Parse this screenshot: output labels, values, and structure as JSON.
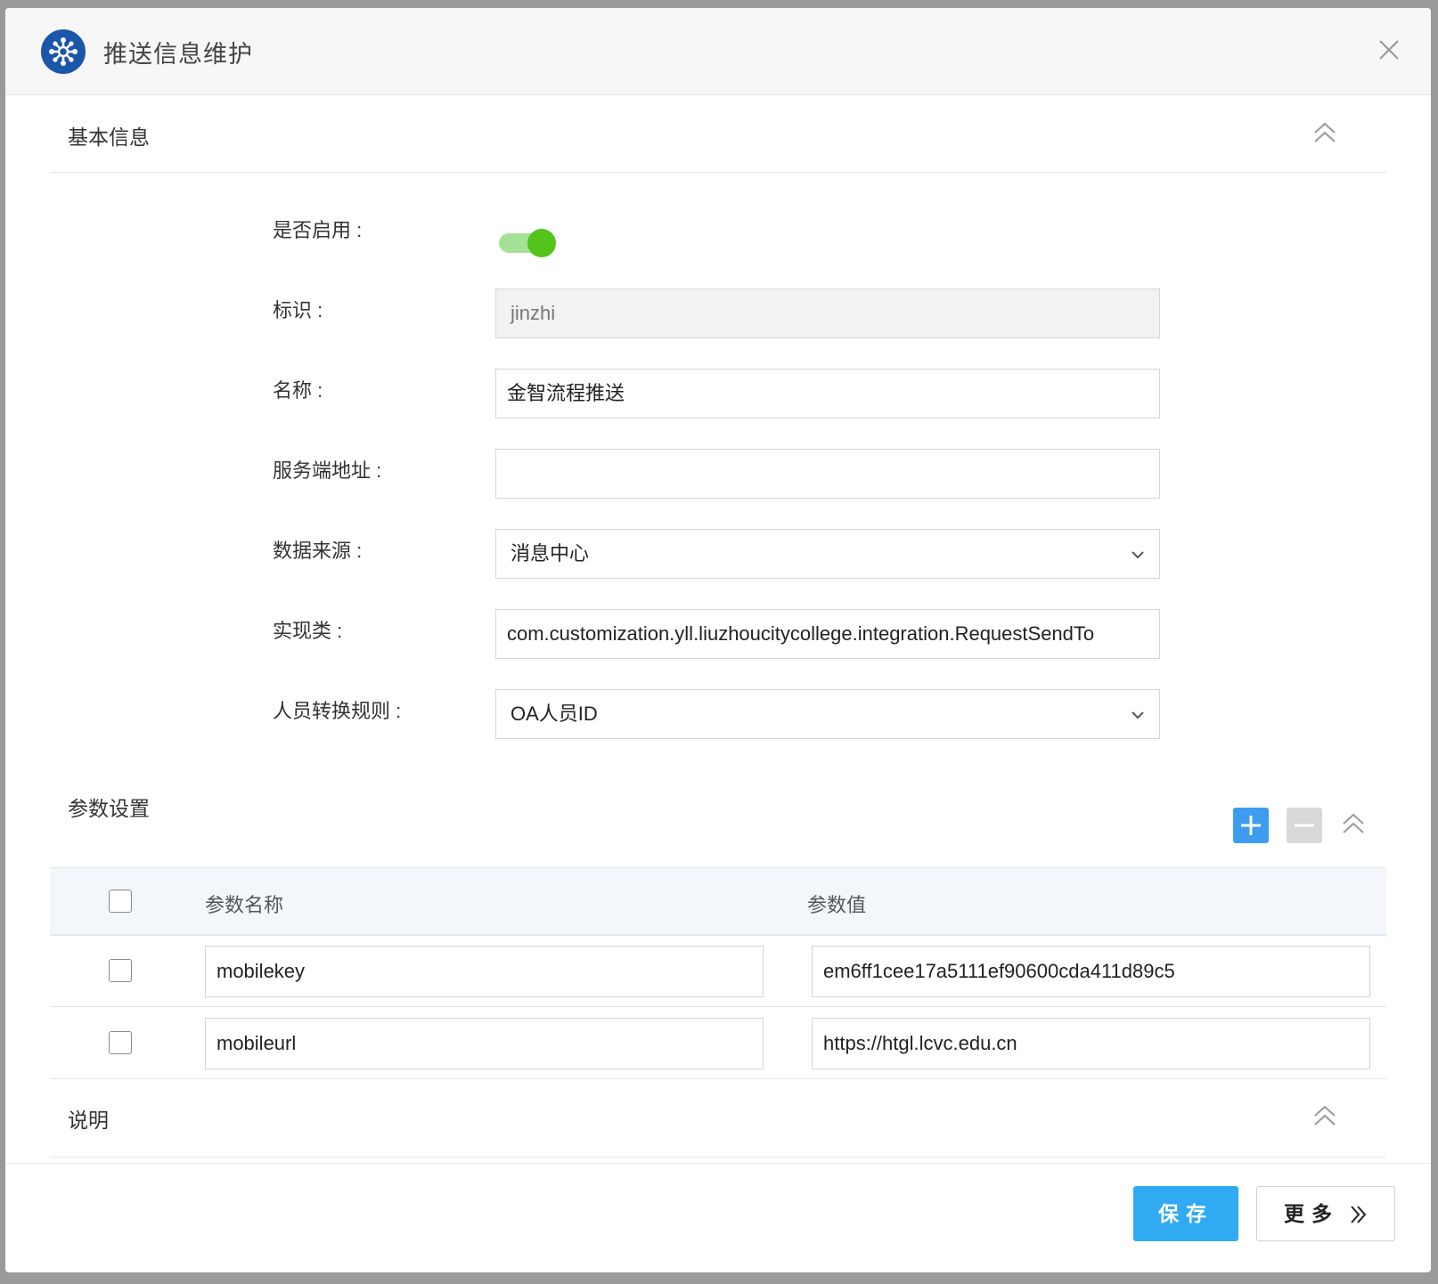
{
  "dialog": {
    "title": "推送信息维护",
    "icon": "app-logo-icon",
    "close_icon": "close-icon"
  },
  "basic_section": {
    "title": "基本信息",
    "collapse_icon": "double-chevron-up-icon"
  },
  "form": {
    "enabled": {
      "label": "是否启用 :",
      "value": true
    },
    "identifier": {
      "label": "标识 :",
      "value": "jinzhi"
    },
    "name": {
      "label": "名称 :",
      "value": "金智流程推送"
    },
    "server_address": {
      "label": "服务端地址 :",
      "value": ""
    },
    "data_source": {
      "label": "数据来源 :",
      "value": "消息中心"
    },
    "impl_class": {
      "label": "实现类 :",
      "value": "com.customization.yll.liuzhoucitycollege.integration.RequestSendTo"
    },
    "person_rule": {
      "label": "人员转换规则 :",
      "value": "OA人员ID"
    }
  },
  "params_section": {
    "title": "参数设置",
    "add_icon": "plus-icon",
    "remove_icon": "minus-icon",
    "collapse_icon": "double-chevron-up-icon",
    "columns": [
      "参数名称",
      "参数值"
    ],
    "rows": [
      {
        "name": "mobilekey",
        "value": "em6ff1cee17a5111ef90600cda411d89c5"
      },
      {
        "name": "mobileurl",
        "value": "https://htgl.lcvc.edu.cn"
      }
    ]
  },
  "notes_section": {
    "title": "说明",
    "collapse_icon": "double-chevron-up-icon"
  },
  "footer": {
    "save_label": "保存",
    "more_label": "更多",
    "more_icon": "double-chevron-right-icon"
  },
  "colors": {
    "primary": "#30aaf2",
    "toggle_on": "#52c41a",
    "add_button": "#3d9cf0",
    "remove_button": "#d9d9d9",
    "logo": "#1b57a8"
  }
}
